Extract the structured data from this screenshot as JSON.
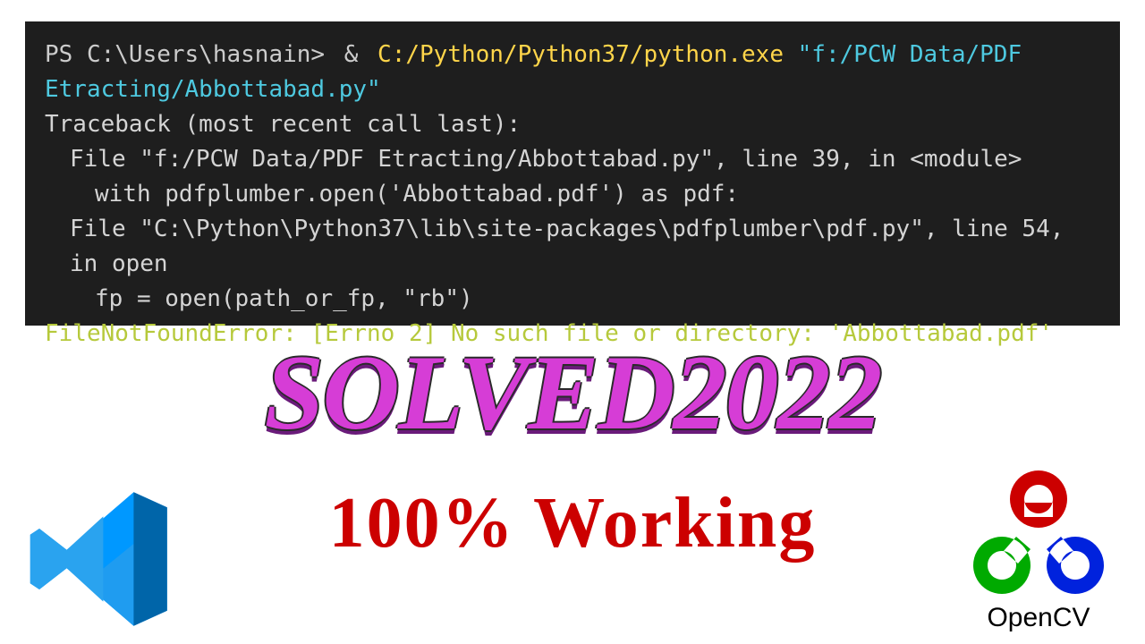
{
  "terminal": {
    "prompt": "PS C:\\Users\\hasnain>",
    "amp": "&",
    "python_path": "C:/Python/Python37/python.exe",
    "script_arg": "\"f:/PCW Data/PDF Etracting/Abbottabad.py\"",
    "traceback_header": "Traceback (most recent call last):",
    "file1": "File \"f:/PCW Data/PDF Etracting/Abbottabad.py\", line 39, in <module>",
    "code1": "with pdfplumber.open('Abbottabad.pdf') as pdf:",
    "file2": "File \"C:\\Python\\Python37\\lib\\site-packages\\pdfplumber\\pdf.py\", line 54, in open",
    "code2": "fp = open(path_or_fp, \"rb\")",
    "error": "FileNotFoundError: [Errno 2] No such file or directory: 'Abbottabad.pdf'"
  },
  "headline": {
    "solved": "SOLVED2022",
    "working": "100% Working"
  },
  "opencv_label": "OpenCV"
}
